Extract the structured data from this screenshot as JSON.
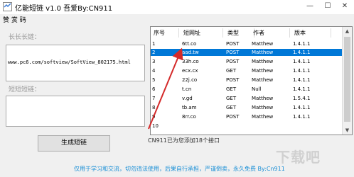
{
  "window": {
    "title": "亿能短链 v1.0 吾爱By:CN911"
  },
  "menu": {
    "donate": "赞 赏 码"
  },
  "long_link": {
    "label": "长长长链：",
    "value": "www.pc6.com/softview/SoftView_802175.html"
  },
  "short_link": {
    "label": "短短短链：",
    "value": ""
  },
  "generate_button": "生成短链",
  "table": {
    "columns": [
      "序号",
      "短网址",
      "类型",
      "作者",
      "版本"
    ],
    "rows": [
      [
        "1",
        "6tt.co",
        "POST",
        "Matthew",
        "1.4.1.1"
      ],
      [
        "2",
        "aad.tw",
        "POST",
        "Matthew",
        "1.4.1.1"
      ],
      [
        "3",
        "33h.co",
        "POST",
        "Matthew",
        "1.4.1.1"
      ],
      [
        "4",
        "ecx.cx",
        "GET",
        "Matthew",
        "1.4.1.1"
      ],
      [
        "5",
        "22j.co",
        "POST",
        "Matthew",
        "1.4.1.1"
      ],
      [
        "6",
        "t.cn",
        "GET",
        "Null",
        "1.4.1.1"
      ],
      [
        "7",
        "v.gd",
        "GET",
        "Matthew",
        "1.5.4.1"
      ],
      [
        "8",
        "tb.am",
        "GET",
        "Matthew",
        "1.4.1.1"
      ],
      [
        "9",
        "8rr.co",
        "POST",
        "Matthew",
        "1.4.1.1"
      ],
      [
        "10",
        "",
        "",
        "",
        ""
      ]
    ],
    "selected_index": 1
  },
  "status": "CN911已为您添加18个接口",
  "footer": "仅用于学习和交流，切勿违法使用，后果自行承担，严谨倒卖，永久免费 By:Cn911",
  "watermark": "下载吧",
  "colors": {
    "selection": "#0078d7",
    "arrow": "#d42a2a",
    "footer": "#1a8fd6"
  }
}
